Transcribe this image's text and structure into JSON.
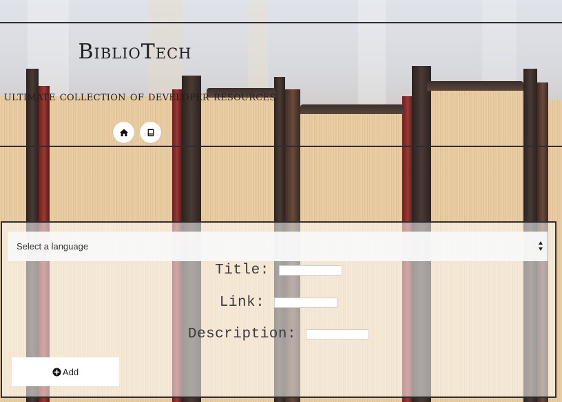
{
  "header": {
    "brand": "BiblioTech",
    "tagline": "e ultimate collection of developer resources"
  },
  "nav": {
    "items": [
      {
        "icon": "home-icon"
      },
      {
        "icon": "book-icon"
      }
    ]
  },
  "form": {
    "language_select": {
      "value": "Select a language"
    },
    "fields": [
      {
        "label": "Title:",
        "value": ""
      },
      {
        "label": "Link:",
        "value": ""
      },
      {
        "label": "Description:",
        "value": ""
      }
    ],
    "add_button": {
      "icon": "plus-circle-icon",
      "label": "Add"
    }
  },
  "colors": {
    "rule": "#2d2d2d",
    "text": "#1e1e1e",
    "panel_border": "#2e2e2e"
  }
}
